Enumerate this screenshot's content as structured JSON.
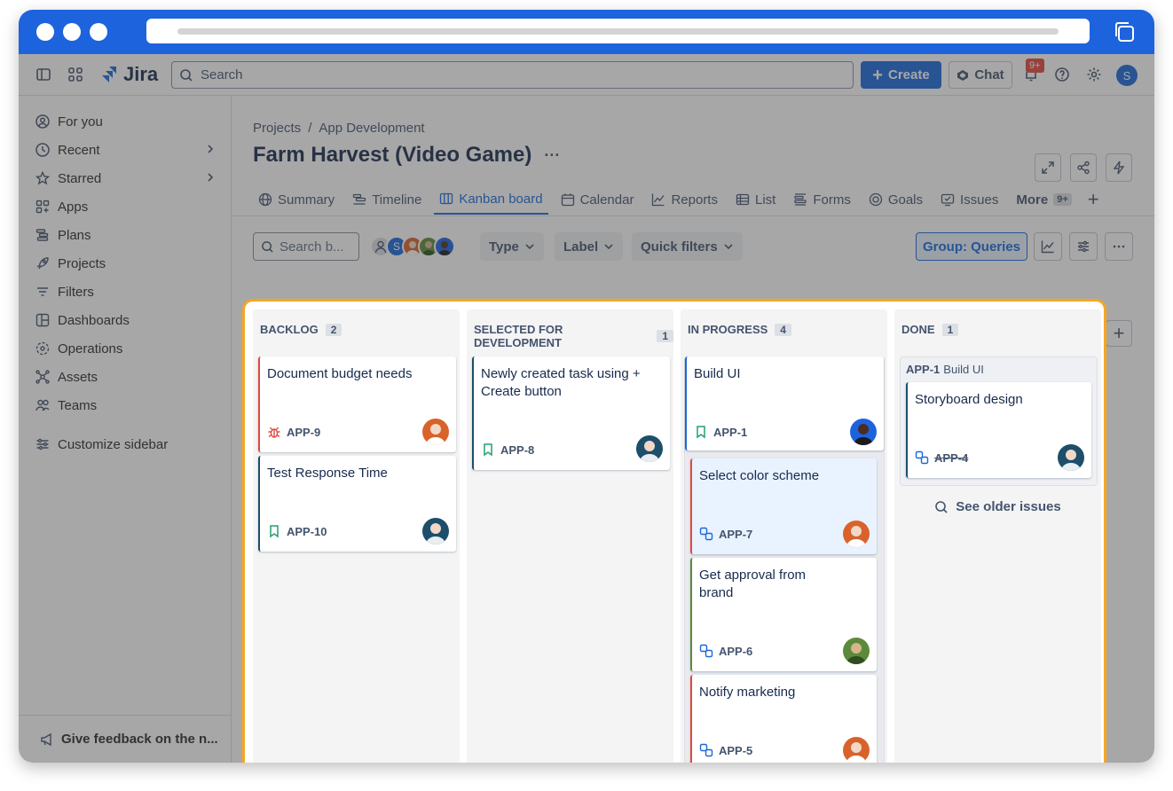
{
  "topnav": {
    "logo_text": "Jira",
    "search_placeholder": "Search",
    "create_label": "Create",
    "chat_label": "Chat",
    "notification_badge": "9+",
    "user_initial": "S"
  },
  "sidebar": {
    "items": [
      {
        "label": "For you",
        "icon": "user-circle-icon"
      },
      {
        "label": "Recent",
        "icon": "clock-icon"
      },
      {
        "label": "Starred",
        "icon": "star-icon"
      },
      {
        "label": "Apps",
        "icon": "apps-icon"
      },
      {
        "label": "Plans",
        "icon": "plans-icon"
      },
      {
        "label": "Projects",
        "icon": "rocket-icon"
      },
      {
        "label": "Filters",
        "icon": "filter-icon"
      },
      {
        "label": "Dashboards",
        "icon": "dashboard-icon"
      },
      {
        "label": "Operations",
        "icon": "operations-icon"
      },
      {
        "label": "Assets",
        "icon": "assets-icon"
      },
      {
        "label": "Teams",
        "icon": "teams-icon"
      }
    ],
    "customize_label": "Customize sidebar",
    "feedback_label": "Give feedback on the n..."
  },
  "header": {
    "breadcrumb": [
      "Projects",
      "App Development"
    ],
    "breadcrumb_sep": "/",
    "title": "Farm Harvest (Video Game)",
    "title_more": "···"
  },
  "tabs": [
    {
      "label": "Summary",
      "icon": "globe-icon"
    },
    {
      "label": "Timeline",
      "icon": "timeline-icon"
    },
    {
      "label": "Kanban board",
      "icon": "board-icon"
    },
    {
      "label": "Calendar",
      "icon": "calendar-icon"
    },
    {
      "label": "Reports",
      "icon": "chart-icon"
    },
    {
      "label": "List",
      "icon": "list-icon"
    },
    {
      "label": "Forms",
      "icon": "forms-icon"
    },
    {
      "label": "Goals",
      "icon": "goal-icon"
    },
    {
      "label": "Issues",
      "icon": "issues-icon"
    },
    {
      "label": "More",
      "badge": "9+"
    }
  ],
  "toolbar": {
    "search_placeholder": "Search b...",
    "avatar_initial": "S",
    "type_label": "Type",
    "label_label": "Label",
    "quick_filters_label": "Quick filters",
    "group_label": "Group: Queries"
  },
  "board": {
    "columns": [
      {
        "name": "BACKLOG",
        "count": "2"
      },
      {
        "name": "SELECTED FOR DEVELOPMENT",
        "count": "1"
      },
      {
        "name": "IN PROGRESS",
        "count": "4"
      },
      {
        "name": "DONE",
        "count": "1"
      }
    ],
    "cards": {
      "app9": {
        "title": "Document budget needs",
        "key": "APP-9"
      },
      "app10": {
        "title": "Test Response Time",
        "key": "APP-10"
      },
      "app8": {
        "title": "Newly created task using + Create button",
        "key": "APP-8"
      },
      "app1": {
        "title": "Build UI",
        "key": "APP-1"
      },
      "app7": {
        "title": "Select color scheme",
        "key": "APP-7"
      },
      "app6": {
        "title": "Get approval from brand",
        "key": "APP-6"
      },
      "app5": {
        "title": "Notify marketing",
        "key": "APP-5"
      },
      "app4": {
        "title": "Storyboard design",
        "key": "APP-4"
      }
    },
    "done_parent": {
      "key": "APP-1",
      "title": "Build UI"
    },
    "see_older": "See older issues"
  },
  "colors": {
    "accent": "#1868db",
    "highlight": "#f5a623",
    "bug": "#e2483d",
    "story": "#22a06b"
  }
}
